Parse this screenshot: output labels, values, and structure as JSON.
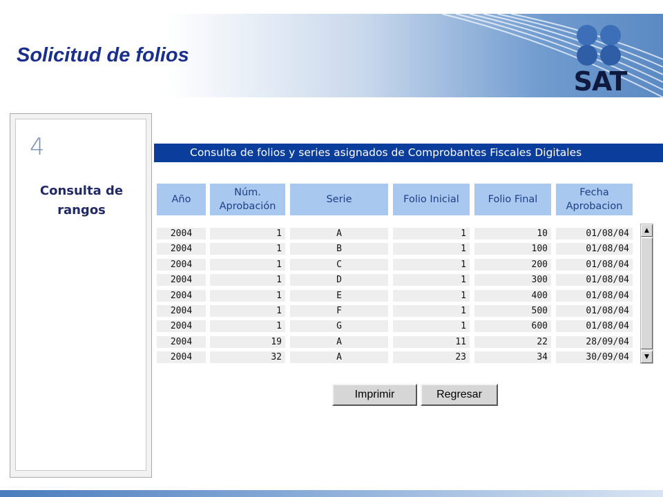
{
  "header": {
    "title": "Solicitud de folios",
    "logo_text": "SAT",
    "logo_icon": "sat-four-dots-logo"
  },
  "step": {
    "number": "4",
    "label_line1": "Consulta de",
    "label_line2": "rangos"
  },
  "table": {
    "title": "Consulta de folios y series asignados de Comprobantes Fiscales Digitales",
    "columns": [
      {
        "line1": "Año",
        "line2": ""
      },
      {
        "line1": "Núm.",
        "line2": "Aprobación"
      },
      {
        "line1": "Serie",
        "line2": ""
      },
      {
        "line1": "Folio Inicial",
        "line2": ""
      },
      {
        "line1": "Folio Final",
        "line2": ""
      },
      {
        "line1": "Fecha",
        "line2": "Aprobacion"
      }
    ],
    "rows": [
      [
        "2004",
        "1",
        "A",
        "1",
        "10",
        "01/08/04"
      ],
      [
        "2004",
        "1",
        "B",
        "1",
        "100",
        "01/08/04"
      ],
      [
        "2004",
        "1",
        "C",
        "1",
        "200",
        "01/08/04"
      ],
      [
        "2004",
        "1",
        "D",
        "1",
        "300",
        "01/08/04"
      ],
      [
        "2004",
        "1",
        "E",
        "1",
        "400",
        "01/08/04"
      ],
      [
        "2004",
        "1",
        "F",
        "1",
        "500",
        "01/08/04"
      ],
      [
        "2004",
        "1",
        "G",
        "1",
        "600",
        "01/08/04"
      ],
      [
        "2004",
        "19",
        "A",
        "11",
        "22",
        "28/09/04"
      ],
      [
        "2004",
        "32",
        "A",
        "23",
        "34",
        "30/09/04"
      ]
    ]
  },
  "buttons": {
    "print_label": "Imprimir",
    "back_label": "Regresar"
  },
  "colors": {
    "title_blue": "#1a2e8c",
    "table_title_bg": "#0a3d9c",
    "header_bg": "#a9c8ef",
    "cell_bg": "#eeeeee"
  }
}
